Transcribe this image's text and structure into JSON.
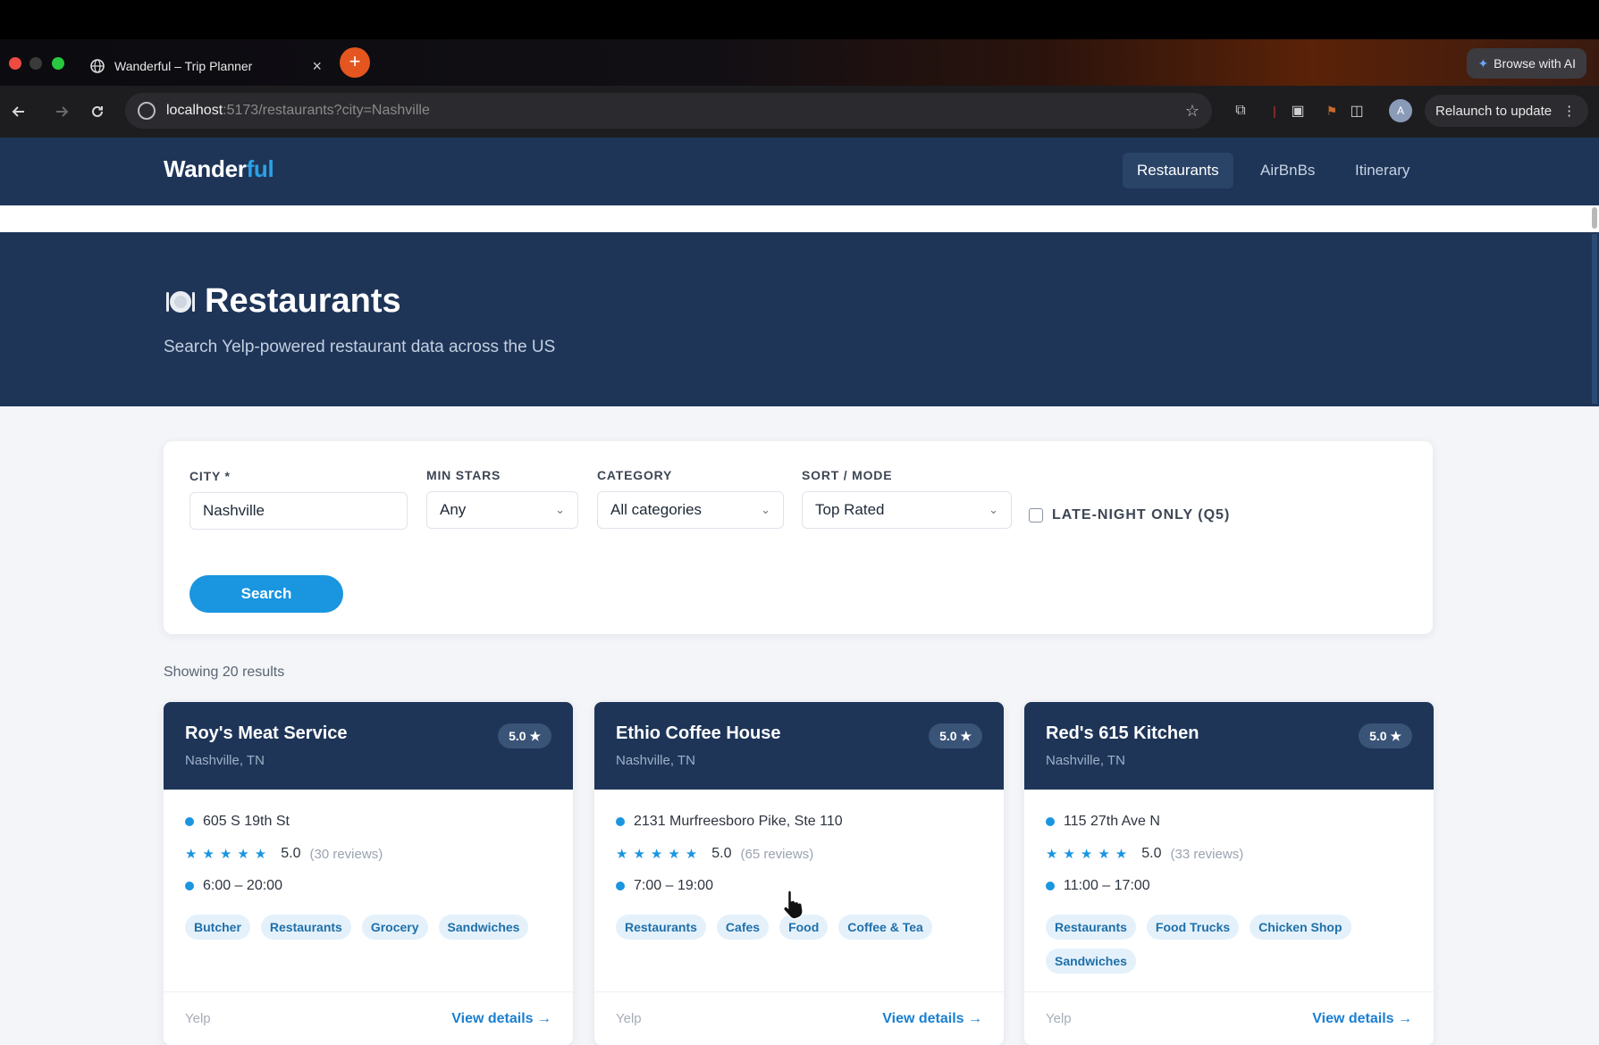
{
  "browser": {
    "tab_title": "Wanderful – Trip Planner",
    "tab_close": "×",
    "new_tab_label": "+",
    "browse_ai_label": "Browse with AI",
    "url_host": "localhost",
    "url_path": ":5173/restaurants?city=Nashville",
    "relaunch_label": "Relaunch to update",
    "profile_initial": "A"
  },
  "app": {
    "logo_main": "Wander",
    "logo_accent": "ful",
    "nav": [
      {
        "label": "Restaurants",
        "active": true
      },
      {
        "label": "AirBnBs",
        "active": false
      },
      {
        "label": "Itinerary",
        "active": false
      }
    ]
  },
  "hero": {
    "title": "Restaurants",
    "subtitle": "Search Yelp-powered restaurant data across the US"
  },
  "filters": {
    "city_label": "CITY *",
    "city_value": "Nashville",
    "min_stars_label": "MIN STARS",
    "min_stars_value": "Any",
    "category_label": "CATEGORY",
    "category_value": "All categories",
    "sort_label": "SORT / MODE",
    "sort_value": "Top Rated",
    "late_night_label": "LATE-NIGHT ONLY (Q5)",
    "late_night_checked": false,
    "search_label": "Search"
  },
  "results": {
    "count_text": "Showing 20 results",
    "cards": [
      {
        "name": "Roy's Meat Service",
        "location": "Nashville, TN",
        "badge": "5.0 ★",
        "address": "605 S 19th St",
        "stars": "★★★★★",
        "score": "5.0",
        "reviews": "(30 reviews)",
        "hours": "6:00 – 20:00",
        "tags": [
          "Butcher",
          "Restaurants",
          "Grocery",
          "Sandwiches"
        ],
        "source": "Yelp",
        "link": "View details →"
      },
      {
        "name": "Ethio Coffee House",
        "location": "Nashville, TN",
        "badge": "5.0 ★",
        "address": "2131 Murfreesboro Pike, Ste 110",
        "stars": "★★★★★",
        "score": "5.0",
        "reviews": "(65 reviews)",
        "hours": "7:00 – 19:00",
        "tags": [
          "Restaurants",
          "Cafes",
          "Food",
          "Coffee & Tea"
        ],
        "source": "Yelp",
        "link": "View details →"
      },
      {
        "name": "Red's 615 Kitchen",
        "location": "Nashville, TN",
        "badge": "5.0 ★",
        "address": "115 27th Ave N",
        "stars": "★★★★★",
        "score": "5.0",
        "reviews": "(33 reviews)",
        "hours": "11:00 – 17:00",
        "tags": [
          "Restaurants",
          "Food Trucks",
          "Chicken Shop",
          "Sandwiches"
        ],
        "source": "Yelp",
        "link": "View details →"
      }
    ]
  },
  "colors": {
    "navy": "#1e3558",
    "accent": "#1a95e0",
    "tag_bg": "#e4f1fb"
  }
}
